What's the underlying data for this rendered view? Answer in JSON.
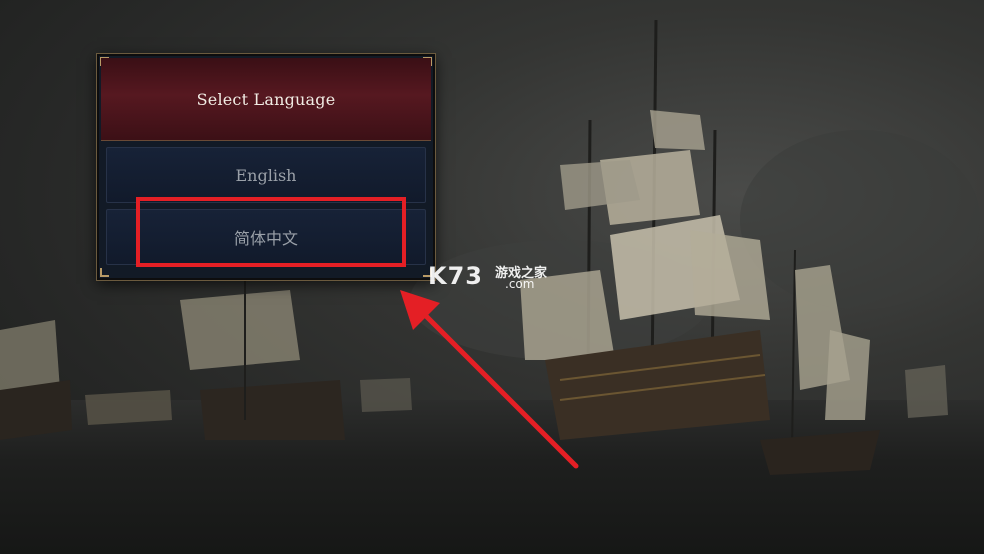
{
  "dialog": {
    "title": "Select Language",
    "options": [
      {
        "label": "English"
      },
      {
        "label": "简体中文"
      }
    ]
  },
  "annotation": {
    "color": "#e41f25"
  },
  "watermark": {
    "logo": "K73",
    "chinese": "游戏之家",
    "domain": ".com"
  },
  "colors": {
    "header": "#561820",
    "panel": "#121a26",
    "option": "#172237"
  }
}
